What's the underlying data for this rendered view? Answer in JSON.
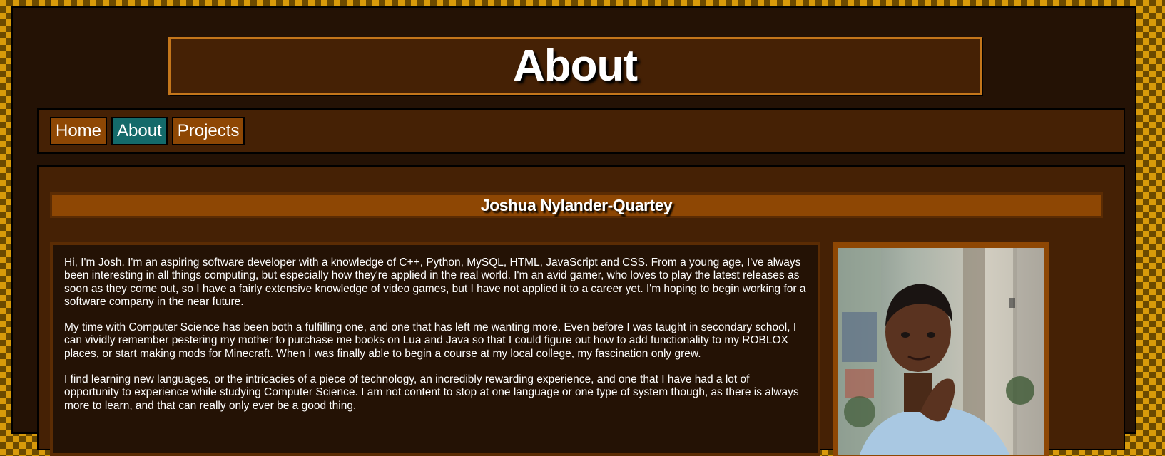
{
  "page": {
    "title": "About"
  },
  "nav": {
    "items": [
      {
        "label": "Home",
        "active": false
      },
      {
        "label": "About",
        "active": true
      },
      {
        "label": "Projects",
        "active": false
      }
    ]
  },
  "profile": {
    "name": "Joshua Nylander-Quartey",
    "paragraphs": [
      "Hi, I'm Josh. I'm an aspiring software developer with a knowledge of C++, Python, MySQL, HTML, JavaScript and CSS. From a young age, I've always been interesting in all things computing, but especially how they're applied in the real world. I'm an avid gamer, who loves to play the latest releases as soon as they come out, so I have a fairly extensive knowledge of video games, but I have not applied it to a career yet. I'm hoping to begin working for a software company in the near future.",
      "My time with Computer Science has been both a fulfilling one, and one that has left me wanting more. Even before I was taught in secondary school, I can vividly remember pestering my mother to purchase me books on Lua and Java so that I could figure out how to add functionality to my ROBLOX places, or start making mods for Minecraft. When I was finally able to begin a course at my local college, my fascination only grew.",
      "I find learning new languages, or the intricacies of a piece of technology, an incredibly rewarding experience, and one that I have had a lot of opportunity to experience while studying Computer Science. I am not content to stop at one language or one type of system though, as there is always more to learn, and that can really only ever be a good thing."
    ]
  },
  "colors": {
    "accent_orange": "#8e4704",
    "active_teal": "#146a6a",
    "panel_brown": "#452105",
    "dark_brown": "#241205",
    "border_gold": "#c4761b"
  }
}
